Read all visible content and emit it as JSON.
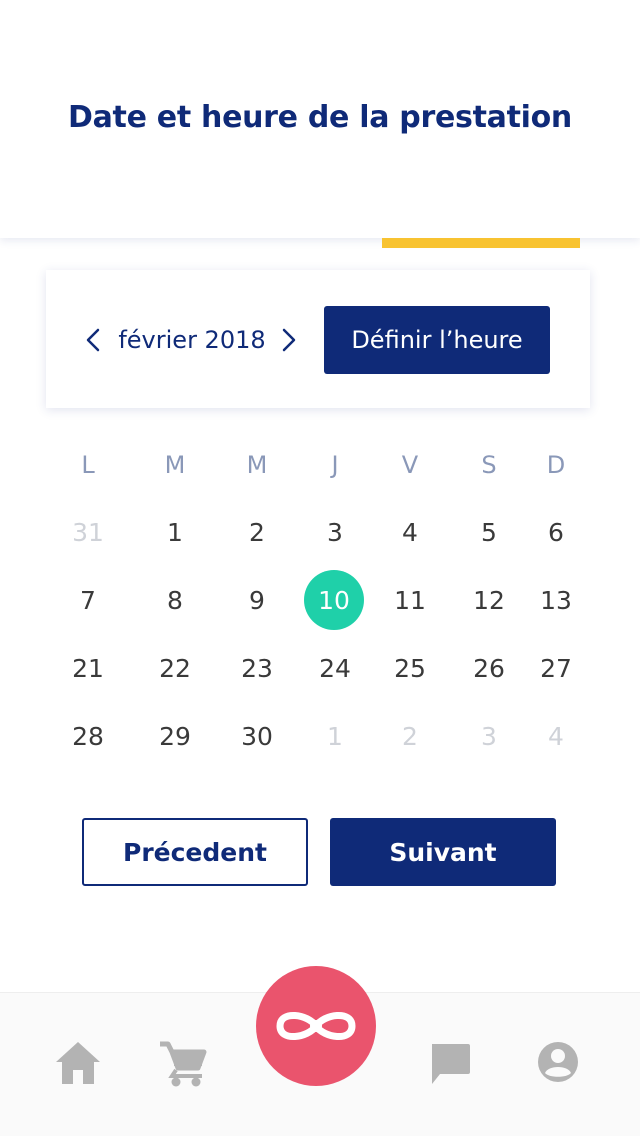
{
  "header": {
    "title": "Date et heure de la prestation",
    "progress_color": "#f8c331"
  },
  "month_nav": {
    "prev_icon": "chevron-left-icon",
    "month_label": "février 2018",
    "next_icon": "chevron-right-icon",
    "set_time_label": "Définir l’heure"
  },
  "calendar": {
    "weekdays": [
      "L",
      "M",
      "M",
      "J",
      "V",
      "S",
      "D"
    ],
    "weeks": [
      [
        "31",
        "1",
        "2",
        "3",
        "4",
        "5",
        "6"
      ],
      [
        "7",
        "8",
        "9",
        "10",
        "11",
        "12",
        "13"
      ],
      [
        "21",
        "22",
        "23",
        "24",
        "25",
        "26",
        "27"
      ],
      [
        "28",
        "29",
        "30",
        "1",
        "2",
        "3",
        "4"
      ]
    ],
    "muted": [
      [
        true,
        false,
        false,
        false,
        false,
        false,
        false
      ],
      [
        false,
        false,
        false,
        false,
        false,
        false,
        false
      ],
      [
        false,
        false,
        false,
        false,
        false,
        false,
        false
      ],
      [
        false,
        false,
        false,
        true,
        true,
        true,
        true
      ]
    ],
    "selected_day": "10",
    "selected_color": "#1fd0a9"
  },
  "actions": {
    "previous_label": "Précedent",
    "next_label": "Suivant"
  },
  "tabbar": {
    "items": [
      "home-icon",
      "cart-icon",
      "infinity-icon",
      "chat-icon",
      "account-icon"
    ],
    "fab_color": "#ea546d"
  },
  "colors": {
    "primary": "#0f2a78",
    "accent": "#1fd0a9",
    "highlight": "#f8c331",
    "fab": "#ea546d"
  }
}
